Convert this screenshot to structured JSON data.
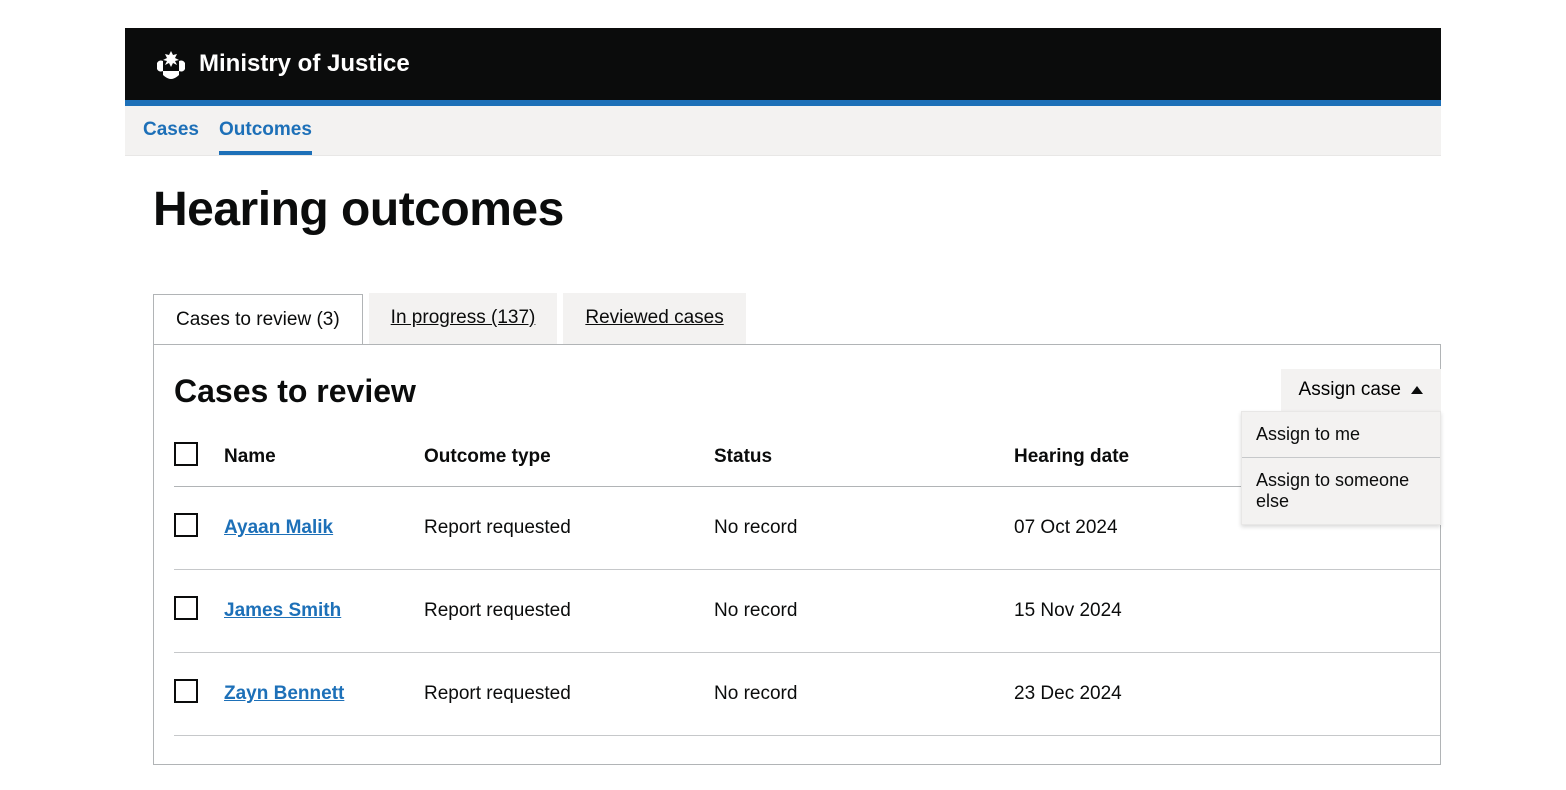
{
  "header": {
    "org_name": "Ministry of Justice"
  },
  "nav": {
    "items": [
      {
        "label": "Cases",
        "active": false
      },
      {
        "label": "Outcomes",
        "active": true
      }
    ]
  },
  "page": {
    "title": "Hearing outcomes"
  },
  "tabs": {
    "items": [
      {
        "label": "Cases to review (3)",
        "active": true
      },
      {
        "label": "In progress (137)",
        "active": false
      },
      {
        "label": "Reviewed cases",
        "active": false
      }
    ]
  },
  "panel": {
    "title": "Cases to review"
  },
  "assign": {
    "button_label": "Assign case",
    "menu": [
      "Assign to me",
      "Assign to someone else"
    ]
  },
  "table": {
    "headers": {
      "name": "Name",
      "outcome_type": "Outcome type",
      "status": "Status",
      "hearing_date": "Hearing date"
    },
    "rows": [
      {
        "name": "Ayaan Malik",
        "outcome_type": "Report requested",
        "status": "No record",
        "hearing_date": "07 Oct 2024"
      },
      {
        "name": "James Smith",
        "outcome_type": "Report requested",
        "status": "No record",
        "hearing_date": "15 Nov 2024"
      },
      {
        "name": "Zayn Bennett",
        "outcome_type": "Report requested",
        "status": "No record",
        "hearing_date": "23 Dec 2024"
      }
    ]
  }
}
